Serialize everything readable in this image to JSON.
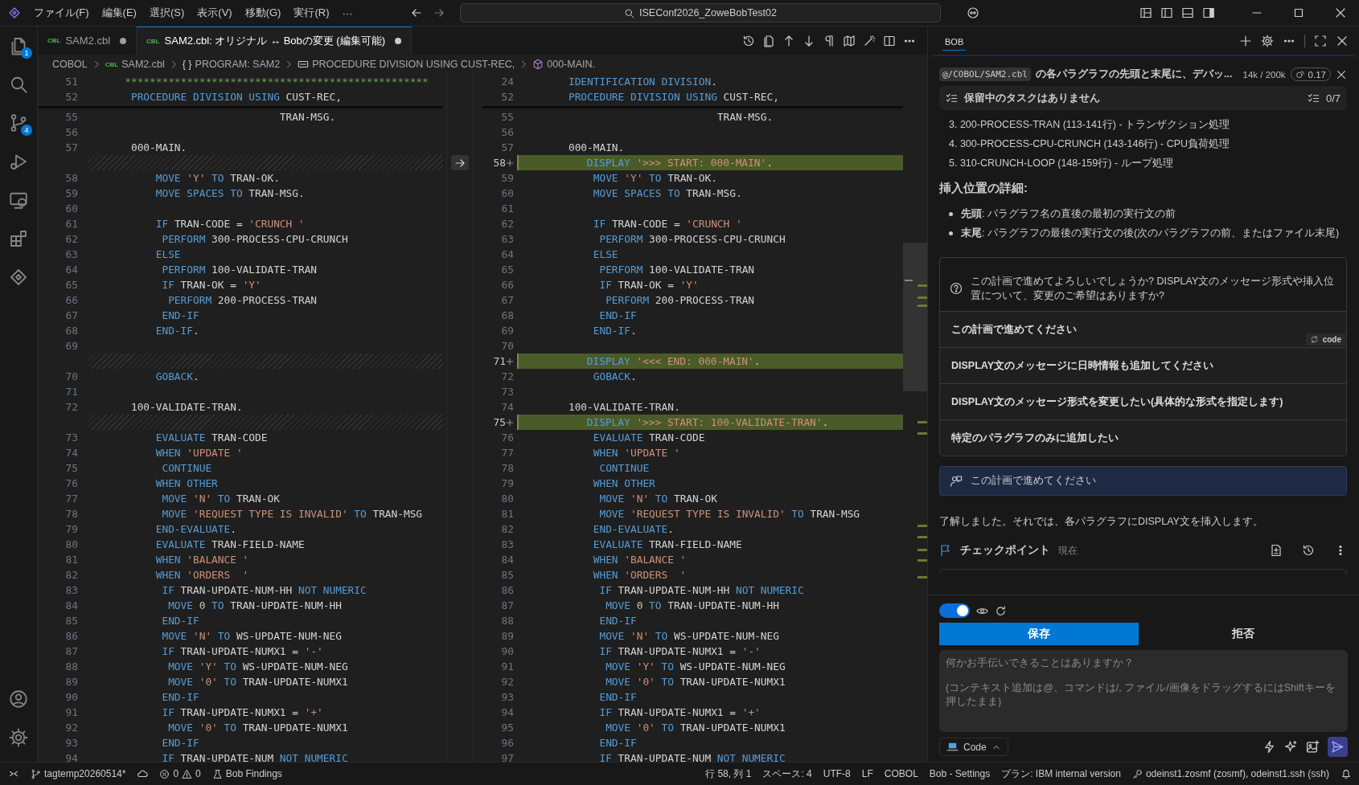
{
  "title_bar": {
    "menu": [
      "ファイル(F)",
      "編集(E)",
      "選択(S)",
      "表示(V)",
      "移動(G)",
      "実行(R)",
      "···"
    ],
    "search": "ISEConf2026_ZoweBobTest02"
  },
  "activity_bar": [
    {
      "kind": "explorer",
      "badge": "1"
    },
    {
      "kind": "search"
    },
    {
      "kind": "source-control",
      "badge": "4"
    },
    {
      "kind": "run"
    },
    {
      "kind": "remote"
    },
    {
      "kind": "extensions"
    },
    {
      "kind": "bob"
    }
  ],
  "editor": {
    "tabs": [
      {
        "badge": "CBL",
        "label": "SAM2.cbl",
        "selected": false,
        "dirty": true
      },
      {
        "badge": "CBL",
        "label": "SAM2.cbl: オリジナル ↔ Bobの変更 (編集可能)",
        "selected": true,
        "dirty": true
      }
    ],
    "breadcrumbs": [
      {
        "kind": "folder",
        "label": "COBOL"
      },
      {
        "kind": "file",
        "badge": "CBL",
        "label": "SAM2.cbl"
      },
      {
        "kind": "braces",
        "glyph": "{ }",
        "label": "PROGRAM: SAM2"
      },
      {
        "kind": "section",
        "label": "PROCEDURE DIVISION USING CUST-REC,"
      },
      {
        "kind": "paragraph",
        "label": "000-MAIN."
      }
    ],
    "original": {
      "sticky": [
        {
          "number": "51",
          "tokens": [
            {
              "kind": "comment",
              "text": "      *************************************************"
            }
          ]
        },
        {
          "number": "52",
          "tokens": [
            {
              "kind": "keyword",
              "text": "       PROCEDURE DIVISION USING "
            },
            {
              "kind": "name",
              "text": "CUST-REC,"
            }
          ]
        }
      ],
      "lines": [
        {
          "number": "55",
          "kind": "code",
          "tokens": [
            {
              "kind": "name",
              "text": "                               TRAN-MSG."
            }
          ]
        },
        {
          "number": "56",
          "kind": "code"
        },
        {
          "number": "57",
          "kind": "code",
          "tokens": [
            {
              "kind": "name",
              "text": "       000-MAIN."
            }
          ]
        },
        {
          "kind": "filler"
        },
        {
          "number": "58",
          "kind": "code",
          "tokens": [
            {
              "kind": "keyword",
              "text": "           MOVE "
            },
            {
              "kind": "string",
              "text": "'Y'"
            },
            {
              "kind": "keyword",
              "text": " TO "
            },
            {
              "kind": "name",
              "text": "TRAN-OK."
            }
          ]
        },
        {
          "number": "59",
          "kind": "code",
          "tokens": [
            {
              "kind": "keyword",
              "text": "           MOVE SPACES TO "
            },
            {
              "kind": "name",
              "text": "TRAN-MSG."
            }
          ]
        },
        {
          "number": "60",
          "kind": "code"
        },
        {
          "number": "61",
          "kind": "code",
          "tokens": [
            {
              "kind": "keyword",
              "text": "           IF "
            },
            {
              "kind": "name",
              "text": "TRAN-CODE = "
            },
            {
              "kind": "string",
              "text": "'CRUNCH '"
            }
          ]
        },
        {
          "number": "62",
          "kind": "code",
          "tokens": [
            {
              "kind": "keyword",
              "text": "            PERFORM "
            },
            {
              "kind": "name",
              "text": "300-PROCESS-CPU-CRUNCH"
            }
          ]
        },
        {
          "number": "63",
          "kind": "code",
          "tokens": [
            {
              "kind": "keyword",
              "text": "           ELSE"
            }
          ]
        },
        {
          "number": "64",
          "kind": "code",
          "tokens": [
            {
              "kind": "keyword",
              "text": "            PERFORM "
            },
            {
              "kind": "name",
              "text": "100-VALIDATE-TRAN"
            }
          ]
        },
        {
          "number": "65",
          "kind": "code",
          "tokens": [
            {
              "kind": "keyword",
              "text": "            IF "
            },
            {
              "kind": "name",
              "text": "TRAN-OK = "
            },
            {
              "kind": "string",
              "text": "'Y'"
            }
          ]
        },
        {
          "number": "66",
          "kind": "code",
          "tokens": [
            {
              "kind": "keyword",
              "text": "             PERFORM "
            },
            {
              "kind": "name",
              "text": "200-PROCESS-TRAN"
            }
          ]
        },
        {
          "number": "67",
          "kind": "code",
          "tokens": [
            {
              "kind": "keyword",
              "text": "            END-IF"
            }
          ]
        },
        {
          "number": "68",
          "kind": "code",
          "tokens": [
            {
              "kind": "keyword",
              "text": "           END-IF"
            },
            {
              "kind": "name",
              "text": "."
            }
          ]
        },
        {
          "number": "69",
          "kind": "code"
        },
        {
          "kind": "filler"
        },
        {
          "number": "70",
          "kind": "code",
          "tokens": [
            {
              "kind": "keyword",
              "text": "           GOBACK"
            },
            {
              "kind": "name",
              "text": "."
            }
          ]
        },
        {
          "number": "71",
          "kind": "code"
        },
        {
          "number": "72",
          "kind": "code",
          "tokens": [
            {
              "kind": "name",
              "text": "       100-VALIDATE-TRAN."
            }
          ]
        },
        {
          "kind": "filler"
        },
        {
          "number": "73",
          "kind": "code",
          "tokens": [
            {
              "kind": "keyword",
              "text": "           EVALUATE "
            },
            {
              "kind": "name",
              "text": "TRAN-CODE"
            }
          ]
        },
        {
          "number": "74",
          "kind": "code",
          "tokens": [
            {
              "kind": "keyword",
              "text": "           WHEN "
            },
            {
              "kind": "string",
              "text": "'UPDATE '"
            }
          ]
        },
        {
          "number": "75",
          "kind": "code",
          "tokens": [
            {
              "kind": "keyword",
              "text": "            CONTINUE"
            }
          ]
        },
        {
          "number": "76",
          "kind": "code",
          "tokens": [
            {
              "kind": "keyword",
              "text": "           WHEN OTHER"
            }
          ]
        },
        {
          "number": "77",
          "kind": "code",
          "tokens": [
            {
              "kind": "keyword",
              "text": "            MOVE "
            },
            {
              "kind": "string",
              "text": "'N'"
            },
            {
              "kind": "keyword",
              "text": " TO "
            },
            {
              "kind": "name",
              "text": "TRAN-OK"
            }
          ]
        },
        {
          "number": "78",
          "kind": "code",
          "tokens": [
            {
              "kind": "keyword",
              "text": "            MOVE "
            },
            {
              "kind": "string",
              "text": "'REQUEST TYPE IS INVALID'"
            },
            {
              "kind": "keyword",
              "text": " TO "
            },
            {
              "kind": "name",
              "text": "TRAN-MSG"
            }
          ]
        },
        {
          "number": "79",
          "kind": "code",
          "tokens": [
            {
              "kind": "keyword",
              "text": "           END-EVALUATE"
            },
            {
              "kind": "name",
              "text": "."
            }
          ]
        },
        {
          "number": "80",
          "kind": "code",
          "tokens": [
            {
              "kind": "keyword",
              "text": "           EVALUATE "
            },
            {
              "kind": "name",
              "text": "TRAN-FIELD-NAME"
            }
          ]
        },
        {
          "number": "81",
          "kind": "code",
          "tokens": [
            {
              "kind": "keyword",
              "text": "           WHEN "
            },
            {
              "kind": "string",
              "text": "'BALANCE '"
            }
          ]
        },
        {
          "number": "82",
          "kind": "code",
          "tokens": [
            {
              "kind": "keyword",
              "text": "           WHEN "
            },
            {
              "kind": "string",
              "text": "'ORDERS  '"
            }
          ]
        },
        {
          "number": "83",
          "kind": "code",
          "tokens": [
            {
              "kind": "keyword",
              "text": "            IF "
            },
            {
              "kind": "name",
              "text": "TRAN-UPDATE-NUM-HH "
            },
            {
              "kind": "keyword",
              "text": "NOT NUMERIC"
            }
          ]
        },
        {
          "number": "84",
          "kind": "code",
          "tokens": [
            {
              "kind": "keyword",
              "text": "             MOVE "
            },
            {
              "kind": "number",
              "text": "0"
            },
            {
              "kind": "keyword",
              "text": " TO "
            },
            {
              "kind": "name",
              "text": "TRAN-UPDATE-NUM-HH"
            }
          ]
        },
        {
          "number": "85",
          "kind": "code",
          "tokens": [
            {
              "kind": "keyword",
              "text": "            END-IF"
            }
          ]
        },
        {
          "number": "86",
          "kind": "code",
          "tokens": [
            {
              "kind": "keyword",
              "text": "            MOVE "
            },
            {
              "kind": "string",
              "text": "'N'"
            },
            {
              "kind": "keyword",
              "text": " TO "
            },
            {
              "kind": "name",
              "text": "WS-UPDATE-NUM-NEG"
            }
          ]
        },
        {
          "number": "87",
          "kind": "code",
          "tokens": [
            {
              "kind": "keyword",
              "text": "            IF "
            },
            {
              "kind": "name",
              "text": "TRAN-UPDATE-NUMX1 = "
            },
            {
              "kind": "string",
              "text": "'-'"
            }
          ]
        },
        {
          "number": "88",
          "kind": "code",
          "tokens": [
            {
              "kind": "keyword",
              "text": "             MOVE "
            },
            {
              "kind": "string",
              "text": "'Y'"
            },
            {
              "kind": "keyword",
              "text": " TO "
            },
            {
              "kind": "name",
              "text": "WS-UPDATE-NUM-NEG"
            }
          ]
        },
        {
          "number": "89",
          "kind": "code",
          "tokens": [
            {
              "kind": "keyword",
              "text": "             MOVE "
            },
            {
              "kind": "string",
              "text": "'0'"
            },
            {
              "kind": "keyword",
              "text": " TO "
            },
            {
              "kind": "name",
              "text": "TRAN-UPDATE-NUMX1"
            }
          ]
        },
        {
          "number": "90",
          "kind": "code",
          "tokens": [
            {
              "kind": "keyword",
              "text": "            END-IF"
            }
          ]
        },
        {
          "number": "91",
          "kind": "code",
          "tokens": [
            {
              "kind": "keyword",
              "text": "            IF "
            },
            {
              "kind": "name",
              "text": "TRAN-UPDATE-NUMX1 = "
            },
            {
              "kind": "string",
              "text": "'+'"
            }
          ]
        },
        {
          "number": "92",
          "kind": "code",
          "tokens": [
            {
              "kind": "keyword",
              "text": "             MOVE "
            },
            {
              "kind": "string",
              "text": "'0'"
            },
            {
              "kind": "keyword",
              "text": " TO "
            },
            {
              "kind": "name",
              "text": "TRAN-UPDATE-NUMX1"
            }
          ]
        },
        {
          "number": "93",
          "kind": "code",
          "tokens": [
            {
              "kind": "keyword",
              "text": "            END-IF"
            }
          ]
        },
        {
          "number": "94",
          "kind": "code",
          "tokens": [
            {
              "kind": "keyword",
              "text": "            IF "
            },
            {
              "kind": "name",
              "text": "TRAN-UPDATE-NUM "
            },
            {
              "kind": "keyword",
              "text": "NOT NUMERIC"
            }
          ]
        }
      ]
    },
    "modified": {
      "sticky": [
        {
          "number": "24",
          "tokens": [
            {
              "kind": "keyword",
              "text": "       IDENTIFICATION DIVISION"
            },
            {
              "kind": "name",
              "text": "."
            }
          ]
        },
        {
          "number": "52",
          "tokens": [
            {
              "kind": "keyword",
              "text": "       PROCEDURE DIVISION USING "
            },
            {
              "kind": "name",
              "text": "CUST-REC,"
            }
          ]
        }
      ],
      "lines": [
        {
          "number": "55",
          "kind": "code",
          "tokens": [
            {
              "kind": "name",
              "text": "                               TRAN-MSG."
            }
          ]
        },
        {
          "number": "56",
          "kind": "code"
        },
        {
          "number": "57",
          "kind": "code",
          "tokens": [
            {
              "kind": "name",
              "text": "       000-MAIN."
            }
          ]
        },
        {
          "number": "58",
          "kind": "added",
          "tokens": [
            {
              "kind": "keyword",
              "text": "           DISPLAY "
            },
            {
              "kind": "string",
              "text": "'>>> START: 000-MAIN'"
            },
            {
              "kind": "name",
              "text": "."
            }
          ]
        },
        {
          "number": "59",
          "kind": "code",
          "tokens": [
            {
              "kind": "keyword",
              "text": "           MOVE "
            },
            {
              "kind": "string",
              "text": "'Y'"
            },
            {
              "kind": "keyword",
              "text": " TO "
            },
            {
              "kind": "name",
              "text": "TRAN-OK."
            }
          ]
        },
        {
          "number": "60",
          "kind": "code",
          "tokens": [
            {
              "kind": "keyword",
              "text": "           MOVE SPACES TO "
            },
            {
              "kind": "name",
              "text": "TRAN-MSG."
            }
          ]
        },
        {
          "number": "61",
          "kind": "code"
        },
        {
          "number": "62",
          "kind": "code",
          "tokens": [
            {
              "kind": "keyword",
              "text": "           IF "
            },
            {
              "kind": "name",
              "text": "TRAN-CODE = "
            },
            {
              "kind": "string",
              "text": "'CRUNCH '"
            }
          ]
        },
        {
          "number": "63",
          "kind": "code",
          "tokens": [
            {
              "kind": "keyword",
              "text": "            PERFORM "
            },
            {
              "kind": "name",
              "text": "300-PROCESS-CPU-CRUNCH"
            }
          ]
        },
        {
          "number": "64",
          "kind": "code",
          "tokens": [
            {
              "kind": "keyword",
              "text": "           ELSE"
            }
          ]
        },
        {
          "number": "65",
          "kind": "code",
          "tokens": [
            {
              "kind": "keyword",
              "text": "            PERFORM "
            },
            {
              "kind": "name",
              "text": "100-VALIDATE-TRAN"
            }
          ]
        },
        {
          "number": "66",
          "kind": "code",
          "tokens": [
            {
              "kind": "keyword",
              "text": "            IF "
            },
            {
              "kind": "name",
              "text": "TRAN-OK = "
            },
            {
              "kind": "string",
              "text": "'Y'"
            }
          ]
        },
        {
          "number": "67",
          "kind": "code",
          "tokens": [
            {
              "kind": "keyword",
              "text": "             PERFORM "
            },
            {
              "kind": "name",
              "text": "200-PROCESS-TRAN"
            }
          ]
        },
        {
          "number": "68",
          "kind": "code",
          "tokens": [
            {
              "kind": "keyword",
              "text": "            END-IF"
            }
          ]
        },
        {
          "number": "69",
          "kind": "code",
          "tokens": [
            {
              "kind": "keyword",
              "text": "           END-IF"
            },
            {
              "kind": "name",
              "text": "."
            }
          ]
        },
        {
          "number": "70",
          "kind": "code"
        },
        {
          "number": "71",
          "kind": "added",
          "tokens": [
            {
              "kind": "keyword",
              "text": "           DISPLAY "
            },
            {
              "kind": "string",
              "text": "'<<< END: 000-MAIN'"
            },
            {
              "kind": "name",
              "text": "."
            }
          ]
        },
        {
          "number": "72",
          "kind": "code",
          "tokens": [
            {
              "kind": "keyword",
              "text": "           GOBACK"
            },
            {
              "kind": "name",
              "text": "."
            }
          ]
        },
        {
          "number": "73",
          "kind": "code"
        },
        {
          "number": "74",
          "kind": "code",
          "tokens": [
            {
              "kind": "name",
              "text": "       100-VALIDATE-TRAN."
            }
          ]
        },
        {
          "number": "75",
          "kind": "added",
          "tokens": [
            {
              "kind": "keyword",
              "text": "           DISPLAY "
            },
            {
              "kind": "string",
              "text": "'>>> START: 100-VALIDATE-TRAN'"
            },
            {
              "kind": "name",
              "text": "."
            }
          ]
        },
        {
          "number": "76",
          "kind": "code",
          "tokens": [
            {
              "kind": "keyword",
              "text": "           EVALUATE "
            },
            {
              "kind": "name",
              "text": "TRAN-CODE"
            }
          ]
        },
        {
          "number": "77",
          "kind": "code",
          "tokens": [
            {
              "kind": "keyword",
              "text": "           WHEN "
            },
            {
              "kind": "string",
              "text": "'UPDATE '"
            }
          ]
        },
        {
          "number": "78",
          "kind": "code",
          "tokens": [
            {
              "kind": "keyword",
              "text": "            CONTINUE"
            }
          ]
        },
        {
          "number": "79",
          "kind": "code",
          "tokens": [
            {
              "kind": "keyword",
              "text": "           WHEN OTHER"
            }
          ]
        },
        {
          "number": "80",
          "kind": "code",
          "tokens": [
            {
              "kind": "keyword",
              "text": "            MOVE "
            },
            {
              "kind": "string",
              "text": "'N'"
            },
            {
              "kind": "keyword",
              "text": " TO "
            },
            {
              "kind": "name",
              "text": "TRAN-OK"
            }
          ]
        },
        {
          "number": "81",
          "kind": "code",
          "tokens": [
            {
              "kind": "keyword",
              "text": "            MOVE "
            },
            {
              "kind": "string",
              "text": "'REQUEST TYPE IS INVALID'"
            },
            {
              "kind": "keyword",
              "text": " TO "
            },
            {
              "kind": "name",
              "text": "TRAN-MSG"
            }
          ]
        },
        {
          "number": "82",
          "kind": "code",
          "tokens": [
            {
              "kind": "keyword",
              "text": "           END-EVALUATE"
            },
            {
              "kind": "name",
              "text": "."
            }
          ]
        },
        {
          "number": "83",
          "kind": "code",
          "tokens": [
            {
              "kind": "keyword",
              "text": "           EVALUATE "
            },
            {
              "kind": "name",
              "text": "TRAN-FIELD-NAME"
            }
          ]
        },
        {
          "number": "84",
          "kind": "code",
          "tokens": [
            {
              "kind": "keyword",
              "text": "           WHEN "
            },
            {
              "kind": "string",
              "text": "'BALANCE '"
            }
          ]
        },
        {
          "number": "85",
          "kind": "code",
          "tokens": [
            {
              "kind": "keyword",
              "text": "           WHEN "
            },
            {
              "kind": "string",
              "text": "'ORDERS  '"
            }
          ]
        },
        {
          "number": "86",
          "kind": "code",
          "tokens": [
            {
              "kind": "keyword",
              "text": "            IF "
            },
            {
              "kind": "name",
              "text": "TRAN-UPDATE-NUM-HH "
            },
            {
              "kind": "keyword",
              "text": "NOT NUMERIC"
            }
          ]
        },
        {
          "number": "87",
          "kind": "code",
          "tokens": [
            {
              "kind": "keyword",
              "text": "             MOVE "
            },
            {
              "kind": "number",
              "text": "0"
            },
            {
              "kind": "keyword",
              "text": " TO "
            },
            {
              "kind": "name",
              "text": "TRAN-UPDATE-NUM-HH"
            }
          ]
        },
        {
          "number": "88",
          "kind": "code",
          "tokens": [
            {
              "kind": "keyword",
              "text": "            END-IF"
            }
          ]
        },
        {
          "number": "89",
          "kind": "code",
          "tokens": [
            {
              "kind": "keyword",
              "text": "            MOVE "
            },
            {
              "kind": "string",
              "text": "'N'"
            },
            {
              "kind": "keyword",
              "text": " TO "
            },
            {
              "kind": "name",
              "text": "WS-UPDATE-NUM-NEG"
            }
          ]
        },
        {
          "number": "90",
          "kind": "code",
          "tokens": [
            {
              "kind": "keyword",
              "text": "            IF "
            },
            {
              "kind": "name",
              "text": "TRAN-UPDATE-NUMX1 = "
            },
            {
              "kind": "string",
              "text": "'-'"
            }
          ]
        },
        {
          "number": "91",
          "kind": "code",
          "tokens": [
            {
              "kind": "keyword",
              "text": "             MOVE "
            },
            {
              "kind": "string",
              "text": "'Y'"
            },
            {
              "kind": "keyword",
              "text": " TO "
            },
            {
              "kind": "name",
              "text": "WS-UPDATE-NUM-NEG"
            }
          ]
        },
        {
          "number": "92",
          "kind": "code",
          "tokens": [
            {
              "kind": "keyword",
              "text": "             MOVE "
            },
            {
              "kind": "string",
              "text": "'0'"
            },
            {
              "kind": "keyword",
              "text": " TO "
            },
            {
              "kind": "name",
              "text": "TRAN-UPDATE-NUMX1"
            }
          ]
        },
        {
          "number": "93",
          "kind": "code",
          "tokens": [
            {
              "kind": "keyword",
              "text": "            END-IF"
            }
          ]
        },
        {
          "number": "94",
          "kind": "code",
          "tokens": [
            {
              "kind": "keyword",
              "text": "            IF "
            },
            {
              "kind": "name",
              "text": "TRAN-UPDATE-NUMX1 = "
            },
            {
              "kind": "string",
              "text": "'+'"
            }
          ]
        },
        {
          "number": "95",
          "kind": "code",
          "tokens": [
            {
              "kind": "keyword",
              "text": "             MOVE "
            },
            {
              "kind": "string",
              "text": "'0'"
            },
            {
              "kind": "keyword",
              "text": " TO "
            },
            {
              "kind": "name",
              "text": "TRAN-UPDATE-NUMX1"
            }
          ]
        },
        {
          "number": "96",
          "kind": "code",
          "tokens": [
            {
              "kind": "keyword",
              "text": "            END-IF"
            }
          ]
        },
        {
          "number": "97",
          "kind": "code",
          "tokens": [
            {
              "kind": "keyword",
              "text": "            IF "
            },
            {
              "kind": "name",
              "text": "TRAN-UPDATE-NUM "
            },
            {
              "kind": "keyword",
              "text": "NOT NUMERIC"
            }
          ]
        }
      ]
    }
  },
  "chat": {
    "tabs": [
      {
        "label": "BOB",
        "selected": true
      }
    ],
    "task": {
      "mention": "@/COBOL/SAM2.cbl",
      "title": "の各パラグラフの先頭と末尾に、デバッ...",
      "tokens": "14k / 200k",
      "cost": "0.17"
    },
    "todo": {
      "label": "保留中のタスクはありません",
      "count": "0/7"
    },
    "steps": [
      "3. 200-PROCESS-TRAN (113-141行) - トランザクション処理",
      "4. 300-PROCESS-CPU-CRUNCH (143-146行) - CPU負荷処理",
      "5. 310-CRUNCH-LOOP (148-159行) - ループ処理"
    ],
    "heading": "挿入位置の詳細:",
    "bullets": [
      "**先頭**: パラグラフ名の直後の最初の実行文の前",
      "**末尾**: パラグラフの最後の実行文の後(次のパラグラフの前、またはファイル末尾)"
    ],
    "question": "この計画で進めてよろしいでしょうか? DISPLAY文のメッセージ形式や挿入位置について、変更のご希望はありますか?",
    "suggestions": [
      {
        "text": "この計画で進めてください",
        "mode": "code"
      },
      {
        "text": "DISPLAY文のメッセージに日時情報も追加してください"
      },
      {
        "text": "DISPLAY文のメッセージ形式を変更したい(具体的な形式を指定します)"
      },
      {
        "text": "特定のパラグラフのみに追加したい"
      }
    ],
    "user_message": "この計画で進めてください",
    "reply": "了解しました。それでは、各パラグラフにDISPLAY文を挿入します。",
    "checkpoint": {
      "label": "チェックポイント",
      "time": "現在"
    },
    "auto_approve": {
      "on": true
    },
    "save": "保存",
    "reject": "拒否",
    "input": {
      "placeholder": "何かお手伝いできることはありますか？\n\n(コンテキスト追加は@、コマンドは/, ファイル/画像をドラッグするにはShiftキーを押したまま)"
    },
    "mode": "Code"
  },
  "status_bar": {
    "branch": "tagtemp20260514*",
    "errors": "0",
    "warnings": "0",
    "findings": "Bob Findings",
    "right": [
      "行 58, 列 1",
      "スペース: 4",
      "UTF-8",
      "LF",
      "COBOL",
      "Bob - Settings",
      "プラン: IBM internal version"
    ],
    "connection": "odeinst1.zosmf (zosmf), odeinst1.ssh (ssh)"
  }
}
